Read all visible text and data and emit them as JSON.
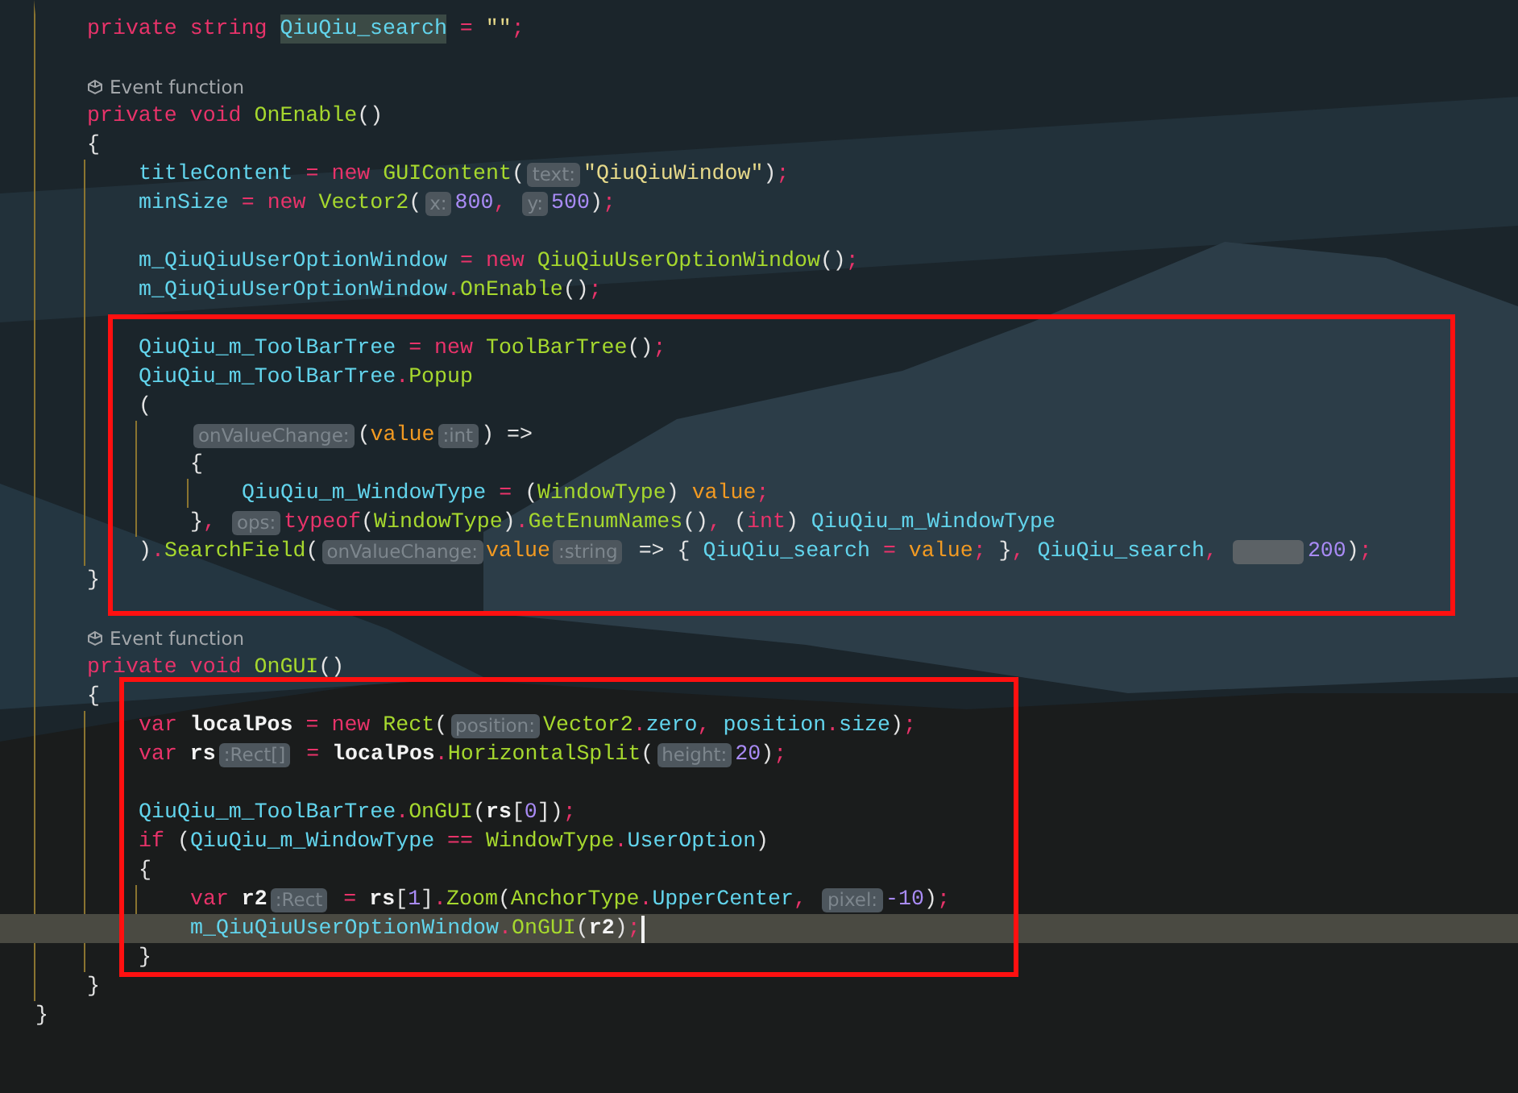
{
  "lines": [
    {
      "kind": "group",
      "children": [
        {
          "kind": "code",
          "tokens": [
            {
              "kind": "kw",
              "text": "private "
            },
            {
              "kind": "kw",
              "text": "string "
            },
            {
              "kind": "mark",
              "text": "QiuQiu_search"
            },
            {
              "kind": "pk",
              "text": " = "
            },
            {
              "kind": "str",
              "text": "\"\""
            },
            {
              "kind": "pk",
              "text": ";"
            }
          ]
        },
        {
          "kind": "blank"
        },
        {
          "kind": "lens",
          "text": "Event function"
        },
        {
          "kind": "code",
          "tokens": [
            {
              "kind": "kw",
              "text": "private "
            },
            {
              "kind": "kw",
              "text": "void "
            },
            {
              "kind": "fn",
              "text": "OnEnable"
            },
            {
              "kind": "p",
              "text": "()"
            }
          ]
        },
        {
          "kind": "code",
          "tokens": [
            {
              "kind": "p",
              "text": "{"
            }
          ],
          "children": [
            {
              "kind": "code",
              "tokens": [
                {
                  "kind": "fld",
                  "text": "titleContent"
                },
                {
                  "kind": "pk",
                  "text": " = "
                },
                {
                  "kind": "kw",
                  "text": "new "
                },
                {
                  "kind": "ty",
                  "text": "GUIContent"
                },
                {
                  "kind": "p",
                  "text": "("
                },
                {
                  "kind": "hint",
                  "text": "text:"
                },
                {
                  "kind": "str",
                  "text": "\"QiuQiuWindow\""
                },
                {
                  "kind": "p",
                  "text": ")"
                },
                {
                  "kind": "pk",
                  "text": ";"
                }
              ]
            },
            {
              "kind": "code",
              "tokens": [
                {
                  "kind": "fld",
                  "text": "minSize"
                },
                {
                  "kind": "pk",
                  "text": " = "
                },
                {
                  "kind": "kw",
                  "text": "new "
                },
                {
                  "kind": "ty",
                  "text": "Vector2"
                },
                {
                  "kind": "p",
                  "text": "("
                },
                {
                  "kind": "hint",
                  "text": "x:"
                },
                {
                  "kind": "num",
                  "text": "800"
                },
                {
                  "kind": "pk",
                  "text": ", "
                },
                {
                  "kind": "hint",
                  "text": "y:"
                },
                {
                  "kind": "num",
                  "text": "500"
                },
                {
                  "kind": "p",
                  "text": ")"
                },
                {
                  "kind": "pk",
                  "text": ";"
                }
              ]
            },
            {
              "kind": "blank"
            },
            {
              "kind": "code",
              "tokens": [
                {
                  "kind": "fld",
                  "text": "m_QiuQiuUserOptionWindow"
                },
                {
                  "kind": "pk",
                  "text": " = "
                },
                {
                  "kind": "kw",
                  "text": "new "
                },
                {
                  "kind": "ty",
                  "text": "QiuQiuUserOptionWindow"
                },
                {
                  "kind": "p",
                  "text": "()"
                },
                {
                  "kind": "pk",
                  "text": ";"
                }
              ]
            },
            {
              "kind": "code",
              "tokens": [
                {
                  "kind": "fld",
                  "text": "m_QiuQiuUserOptionWindow"
                },
                {
                  "kind": "pk",
                  "text": "."
                },
                {
                  "kind": "fn",
                  "text": "OnEnable"
                },
                {
                  "kind": "p",
                  "text": "()"
                },
                {
                  "kind": "pk",
                  "text": ";"
                }
              ]
            },
            {
              "kind": "blank"
            },
            {
              "kind": "code",
              "tokens": [
                {
                  "kind": "fld",
                  "text": "QiuQiu_m_ToolBarTree"
                },
                {
                  "kind": "pk",
                  "text": " = "
                },
                {
                  "kind": "kw",
                  "text": "new "
                },
                {
                  "kind": "ty",
                  "text": "ToolBarTree"
                },
                {
                  "kind": "p",
                  "text": "()"
                },
                {
                  "kind": "pk",
                  "text": ";"
                }
              ]
            },
            {
              "kind": "code",
              "tokens": [
                {
                  "kind": "fld",
                  "text": "QiuQiu_m_ToolBarTree"
                },
                {
                  "kind": "pk",
                  "text": "."
                },
                {
                  "kind": "fn",
                  "text": "Popup"
                }
              ]
            },
            {
              "kind": "code",
              "tokens": [
                {
                  "kind": "p",
                  "text": "("
                }
              ],
              "children": [
                {
                  "kind": "code",
                  "tokens": [
                    {
                      "kind": "hint",
                      "text": "onValueChange:"
                    },
                    {
                      "kind": "p",
                      "text": "("
                    },
                    {
                      "kind": "par",
                      "text": "value"
                    },
                    {
                      "kind": "hint",
                      "text": ":int"
                    },
                    {
                      "kind": "p",
                      "text": ") =>"
                    }
                  ]
                },
                {
                  "kind": "code",
                  "tokens": [
                    {
                      "kind": "p",
                      "text": "{"
                    }
                  ],
                  "children": [
                    {
                      "kind": "code",
                      "tokens": [
                        {
                          "kind": "fld",
                          "text": "QiuQiu_m_WindowType"
                        },
                        {
                          "kind": "pk",
                          "text": " = "
                        },
                        {
                          "kind": "p",
                          "text": "("
                        },
                        {
                          "kind": "ty",
                          "text": "WindowType"
                        },
                        {
                          "kind": "p",
                          "text": ") "
                        },
                        {
                          "kind": "par",
                          "text": "value"
                        },
                        {
                          "kind": "pk",
                          "text": ";"
                        }
                      ]
                    }
                  ]
                },
                {
                  "kind": "code",
                  "tokens": [
                    {
                      "kind": "p",
                      "text": "}"
                    },
                    {
                      "kind": "pk",
                      "text": ", "
                    },
                    {
                      "kind": "hint",
                      "text": "ops:"
                    },
                    {
                      "kind": "kw",
                      "text": "typeof"
                    },
                    {
                      "kind": "p",
                      "text": "("
                    },
                    {
                      "kind": "ty",
                      "text": "WindowType"
                    },
                    {
                      "kind": "p",
                      "text": ")"
                    },
                    {
                      "kind": "pk",
                      "text": "."
                    },
                    {
                      "kind": "fn",
                      "text": "GetEnumNames"
                    },
                    {
                      "kind": "p",
                      "text": "()"
                    },
                    {
                      "kind": "pk",
                      "text": ", "
                    },
                    {
                      "kind": "p",
                      "text": "("
                    },
                    {
                      "kind": "kw",
                      "text": "int"
                    },
                    {
                      "kind": "p",
                      "text": ") "
                    },
                    {
                      "kind": "fld",
                      "text": "QiuQiu_m_WindowType"
                    }
                  ]
                }
              ]
            },
            {
              "kind": "code",
              "tokens": [
                {
                  "kind": "p",
                  "text": ")"
                },
                {
                  "kind": "pk",
                  "text": "."
                },
                {
                  "kind": "fn",
                  "text": "SearchField"
                },
                {
                  "kind": "p",
                  "text": "("
                },
                {
                  "kind": "hint",
                  "text": "onValueChange:"
                },
                {
                  "kind": "par",
                  "text": "value"
                },
                {
                  "kind": "hint",
                  "text": ":string"
                },
                {
                  "kind": "p",
                  "text": " => { "
                },
                {
                  "kind": "fld",
                  "text": "QiuQiu_search"
                },
                {
                  "kind": "pk",
                  "text": " = "
                },
                {
                  "kind": "par",
                  "text": "value"
                },
                {
                  "kind": "pk",
                  "text": ";"
                },
                {
                  "kind": "p",
                  "text": " }"
                },
                {
                  "kind": "pk",
                  "text": ", "
                },
                {
                  "kind": "fld",
                  "text": "QiuQiu_search"
                },
                {
                  "kind": "pk",
                  "text": ", "
                },
                {
                  "kind": "blank"
                },
                {
                  "kind": "num",
                  "text": "200"
                },
                {
                  "kind": "p",
                  "text": ")"
                },
                {
                  "kind": "pk",
                  "text": ";"
                }
              ]
            }
          ]
        },
        {
          "kind": "code",
          "tokens": [
            {
              "kind": "p",
              "text": "}"
            }
          ]
        },
        {
          "kind": "blank"
        },
        {
          "kind": "lens",
          "text": "Event function"
        },
        {
          "kind": "code",
          "tokens": [
            {
              "kind": "kw",
              "text": "private "
            },
            {
              "kind": "kw",
              "text": "void "
            },
            {
              "kind": "fn",
              "text": "OnGUI"
            },
            {
              "kind": "p",
              "text": "()"
            }
          ]
        },
        {
          "kind": "code",
          "tokens": [
            {
              "kind": "p",
              "text": "{"
            }
          ],
          "children": [
            {
              "kind": "code",
              "tokens": [
                {
                  "kind": "kw",
                  "text": "var "
                },
                {
                  "kind": "loc",
                  "text": "localPos"
                },
                {
                  "kind": "pk",
                  "text": " = "
                },
                {
                  "kind": "kw",
                  "text": "new "
                },
                {
                  "kind": "ty",
                  "text": "Rect"
                },
                {
                  "kind": "p",
                  "text": "("
                },
                {
                  "kind": "hint",
                  "text": "position:"
                },
                {
                  "kind": "ty",
                  "text": "Vector2"
                },
                {
                  "kind": "pk",
                  "text": "."
                },
                {
                  "kind": "fld",
                  "text": "zero"
                },
                {
                  "kind": "pk",
                  "text": ", "
                },
                {
                  "kind": "fld",
                  "text": "position"
                },
                {
                  "kind": "pk",
                  "text": "."
                },
                {
                  "kind": "fld",
                  "text": "size"
                },
                {
                  "kind": "p",
                  "text": ")"
                },
                {
                  "kind": "pk",
                  "text": ";"
                }
              ]
            },
            {
              "kind": "code",
              "tokens": [
                {
                  "kind": "kw",
                  "text": "var "
                },
                {
                  "kind": "loc",
                  "text": "rs"
                },
                {
                  "kind": "hint",
                  "text": ":Rect[]"
                },
                {
                  "kind": "pk",
                  "text": " = "
                },
                {
                  "kind": "loc",
                  "text": "localPos"
                },
                {
                  "kind": "pk",
                  "text": "."
                },
                {
                  "kind": "fn",
                  "text": "HorizontalSplit"
                },
                {
                  "kind": "p",
                  "text": "("
                },
                {
                  "kind": "hint",
                  "text": "height:"
                },
                {
                  "kind": "num",
                  "text": "20"
                },
                {
                  "kind": "p",
                  "text": ")"
                },
                {
                  "kind": "pk",
                  "text": ";"
                }
              ]
            },
            {
              "kind": "blank"
            },
            {
              "kind": "code",
              "tokens": [
                {
                  "kind": "fld",
                  "text": "QiuQiu_m_ToolBarTree"
                },
                {
                  "kind": "pk",
                  "text": "."
                },
                {
                  "kind": "fn",
                  "text": "OnGUI"
                },
                {
                  "kind": "p",
                  "text": "("
                },
                {
                  "kind": "loc",
                  "text": "rs"
                },
                {
                  "kind": "p",
                  "text": "["
                },
                {
                  "kind": "num",
                  "text": "0"
                },
                {
                  "kind": "p",
                  "text": "])"
                },
                {
                  "kind": "pk",
                  "text": ";"
                }
              ]
            },
            {
              "kind": "code",
              "tokens": [
                {
                  "kind": "kw",
                  "text": "if "
                },
                {
                  "kind": "p",
                  "text": "("
                },
                {
                  "kind": "fld",
                  "text": "QiuQiu_m_WindowType"
                },
                {
                  "kind": "pk",
                  "text": " == "
                },
                {
                  "kind": "ty",
                  "text": "WindowType"
                },
                {
                  "kind": "pk",
                  "text": "."
                },
                {
                  "kind": "fld",
                  "text": "UserOption"
                },
                {
                  "kind": "p",
                  "text": ")"
                }
              ]
            },
            {
              "kind": "code",
              "tokens": [
                {
                  "kind": "p",
                  "text": "{"
                }
              ],
              "children": [
                {
                  "kind": "code",
                  "tokens": [
                    {
                      "kind": "kw",
                      "text": "var "
                    },
                    {
                      "kind": "loc",
                      "text": "r2"
                    },
                    {
                      "kind": "hint",
                      "text": ":Rect"
                    },
                    {
                      "kind": "pk",
                      "text": " = "
                    },
                    {
                      "kind": "loc",
                      "text": "rs"
                    },
                    {
                      "kind": "p",
                      "text": "["
                    },
                    {
                      "kind": "num",
                      "text": "1"
                    },
                    {
                      "kind": "p",
                      "text": "]"
                    },
                    {
                      "kind": "pk",
                      "text": "."
                    },
                    {
                      "kind": "fn",
                      "text": "Zoom"
                    },
                    {
                      "kind": "p",
                      "text": "("
                    },
                    {
                      "kind": "ty",
                      "text": "AnchorType"
                    },
                    {
                      "kind": "pk",
                      "text": "."
                    },
                    {
                      "kind": "fld",
                      "text": "UpperCenter"
                    },
                    {
                      "kind": "pk",
                      "text": ", "
                    },
                    {
                      "kind": "hint",
                      "text": "pixel:"
                    },
                    {
                      "kind": "num",
                      "text": "-10"
                    },
                    {
                      "kind": "p",
                      "text": ")"
                    },
                    {
                      "kind": "pk",
                      "text": ";"
                    }
                  ]
                },
                {
                  "kind": "code",
                  "current": true,
                  "caret": true,
                  "tokens": [
                    {
                      "kind": "fld",
                      "text": "m_QiuQiuUserOptionWindow"
                    },
                    {
                      "kind": "pk",
                      "text": "."
                    },
                    {
                      "kind": "fn",
                      "text": "OnGUI"
                    },
                    {
                      "kind": "p",
                      "text": "("
                    },
                    {
                      "kind": "loc",
                      "text": "r2"
                    },
                    {
                      "kind": "p",
                      "text": ")"
                    },
                    {
                      "kind": "pk",
                      "text": ";"
                    }
                  ]
                }
              ]
            },
            {
              "kind": "code",
              "tokens": [
                {
                  "kind": "p",
                  "text": "}"
                }
              ]
            }
          ]
        },
        {
          "kind": "code",
          "tokens": [
            {
              "kind": "p",
              "text": "}"
            }
          ]
        }
      ]
    },
    {
      "kind": "code",
      "tokens": [
        {
          "kind": "p",
          "text": "}"
        }
      ]
    }
  ],
  "frames": [
    {
      "kind": "rect"
    },
    {
      "kind": "rect"
    }
  ]
}
